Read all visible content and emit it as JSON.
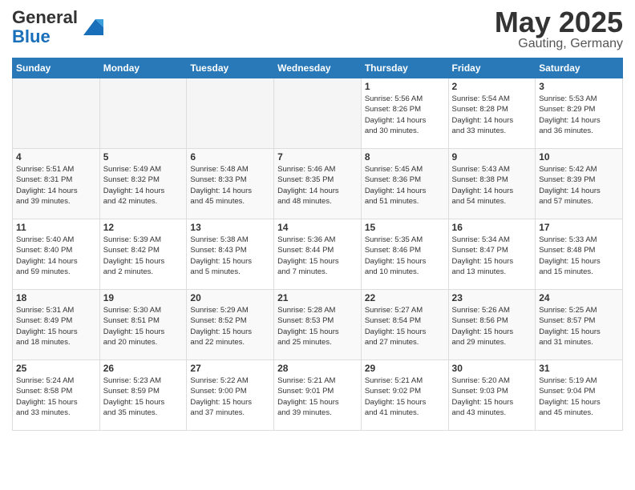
{
  "header": {
    "logo_general": "General",
    "logo_blue": "Blue",
    "month": "May 2025",
    "location": "Gauting, Germany"
  },
  "days_of_week": [
    "Sunday",
    "Monday",
    "Tuesday",
    "Wednesday",
    "Thursday",
    "Friday",
    "Saturday"
  ],
  "weeks": [
    [
      {
        "day": "",
        "info": ""
      },
      {
        "day": "",
        "info": ""
      },
      {
        "day": "",
        "info": ""
      },
      {
        "day": "",
        "info": ""
      },
      {
        "day": "1",
        "info": "Sunrise: 5:56 AM\nSunset: 8:26 PM\nDaylight: 14 hours\nand 30 minutes."
      },
      {
        "day": "2",
        "info": "Sunrise: 5:54 AM\nSunset: 8:28 PM\nDaylight: 14 hours\nand 33 minutes."
      },
      {
        "day": "3",
        "info": "Sunrise: 5:53 AM\nSunset: 8:29 PM\nDaylight: 14 hours\nand 36 minutes."
      }
    ],
    [
      {
        "day": "4",
        "info": "Sunrise: 5:51 AM\nSunset: 8:31 PM\nDaylight: 14 hours\nand 39 minutes."
      },
      {
        "day": "5",
        "info": "Sunrise: 5:49 AM\nSunset: 8:32 PM\nDaylight: 14 hours\nand 42 minutes."
      },
      {
        "day": "6",
        "info": "Sunrise: 5:48 AM\nSunset: 8:33 PM\nDaylight: 14 hours\nand 45 minutes."
      },
      {
        "day": "7",
        "info": "Sunrise: 5:46 AM\nSunset: 8:35 PM\nDaylight: 14 hours\nand 48 minutes."
      },
      {
        "day": "8",
        "info": "Sunrise: 5:45 AM\nSunset: 8:36 PM\nDaylight: 14 hours\nand 51 minutes."
      },
      {
        "day": "9",
        "info": "Sunrise: 5:43 AM\nSunset: 8:38 PM\nDaylight: 14 hours\nand 54 minutes."
      },
      {
        "day": "10",
        "info": "Sunrise: 5:42 AM\nSunset: 8:39 PM\nDaylight: 14 hours\nand 57 minutes."
      }
    ],
    [
      {
        "day": "11",
        "info": "Sunrise: 5:40 AM\nSunset: 8:40 PM\nDaylight: 14 hours\nand 59 minutes."
      },
      {
        "day": "12",
        "info": "Sunrise: 5:39 AM\nSunset: 8:42 PM\nDaylight: 15 hours\nand 2 minutes."
      },
      {
        "day": "13",
        "info": "Sunrise: 5:38 AM\nSunset: 8:43 PM\nDaylight: 15 hours\nand 5 minutes."
      },
      {
        "day": "14",
        "info": "Sunrise: 5:36 AM\nSunset: 8:44 PM\nDaylight: 15 hours\nand 7 minutes."
      },
      {
        "day": "15",
        "info": "Sunrise: 5:35 AM\nSunset: 8:46 PM\nDaylight: 15 hours\nand 10 minutes."
      },
      {
        "day": "16",
        "info": "Sunrise: 5:34 AM\nSunset: 8:47 PM\nDaylight: 15 hours\nand 13 minutes."
      },
      {
        "day": "17",
        "info": "Sunrise: 5:33 AM\nSunset: 8:48 PM\nDaylight: 15 hours\nand 15 minutes."
      }
    ],
    [
      {
        "day": "18",
        "info": "Sunrise: 5:31 AM\nSunset: 8:49 PM\nDaylight: 15 hours\nand 18 minutes."
      },
      {
        "day": "19",
        "info": "Sunrise: 5:30 AM\nSunset: 8:51 PM\nDaylight: 15 hours\nand 20 minutes."
      },
      {
        "day": "20",
        "info": "Sunrise: 5:29 AM\nSunset: 8:52 PM\nDaylight: 15 hours\nand 22 minutes."
      },
      {
        "day": "21",
        "info": "Sunrise: 5:28 AM\nSunset: 8:53 PM\nDaylight: 15 hours\nand 25 minutes."
      },
      {
        "day": "22",
        "info": "Sunrise: 5:27 AM\nSunset: 8:54 PM\nDaylight: 15 hours\nand 27 minutes."
      },
      {
        "day": "23",
        "info": "Sunrise: 5:26 AM\nSunset: 8:56 PM\nDaylight: 15 hours\nand 29 minutes."
      },
      {
        "day": "24",
        "info": "Sunrise: 5:25 AM\nSunset: 8:57 PM\nDaylight: 15 hours\nand 31 minutes."
      }
    ],
    [
      {
        "day": "25",
        "info": "Sunrise: 5:24 AM\nSunset: 8:58 PM\nDaylight: 15 hours\nand 33 minutes."
      },
      {
        "day": "26",
        "info": "Sunrise: 5:23 AM\nSunset: 8:59 PM\nDaylight: 15 hours\nand 35 minutes."
      },
      {
        "day": "27",
        "info": "Sunrise: 5:22 AM\nSunset: 9:00 PM\nDaylight: 15 hours\nand 37 minutes."
      },
      {
        "day": "28",
        "info": "Sunrise: 5:21 AM\nSunset: 9:01 PM\nDaylight: 15 hours\nand 39 minutes."
      },
      {
        "day": "29",
        "info": "Sunrise: 5:21 AM\nSunset: 9:02 PM\nDaylight: 15 hours\nand 41 minutes."
      },
      {
        "day": "30",
        "info": "Sunrise: 5:20 AM\nSunset: 9:03 PM\nDaylight: 15 hours\nand 43 minutes."
      },
      {
        "day": "31",
        "info": "Sunrise: 5:19 AM\nSunset: 9:04 PM\nDaylight: 15 hours\nand 45 minutes."
      }
    ]
  ]
}
